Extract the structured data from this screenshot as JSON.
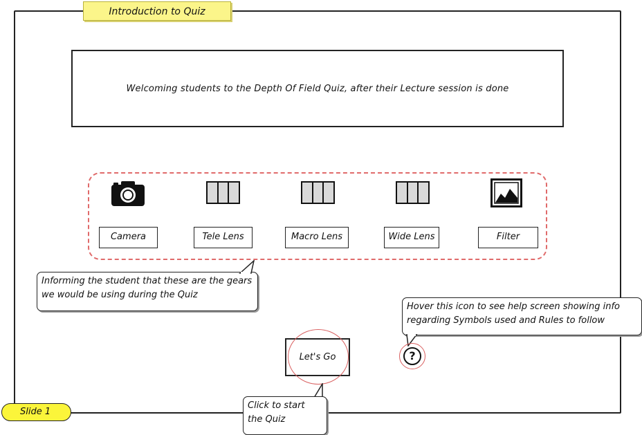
{
  "header": {
    "title": "Introduction to Quiz"
  },
  "welcome": {
    "text": "Welcoming students to the Depth Of Field Quiz, after their Lecture session is done"
  },
  "gears": [
    {
      "label": "Camera",
      "icon": "camera-icon"
    },
    {
      "label": "Tele Lens",
      "icon": "lens-icon"
    },
    {
      "label": "Macro Lens",
      "icon": "lens-icon"
    },
    {
      "label": "Wide Lens",
      "icon": "lens-icon"
    },
    {
      "label": "Filter",
      "icon": "image-icon"
    }
  ],
  "notes": {
    "gears_note": "Informing the student that these are the gears we would be using during the Quiz",
    "help_note": "Hover this icon to see help screen showing info regarding Symbols used and Rules to follow",
    "start_note": "Click to start the Quiz"
  },
  "actions": {
    "start_label": "Let's Go",
    "help_glyph": "?"
  },
  "footer": {
    "slide_label": "Slide 1"
  },
  "colors": {
    "tab_yellow": "#fbf58a",
    "slide_yellow": "#fbf53a",
    "dashed_red": "#e06a6a"
  }
}
